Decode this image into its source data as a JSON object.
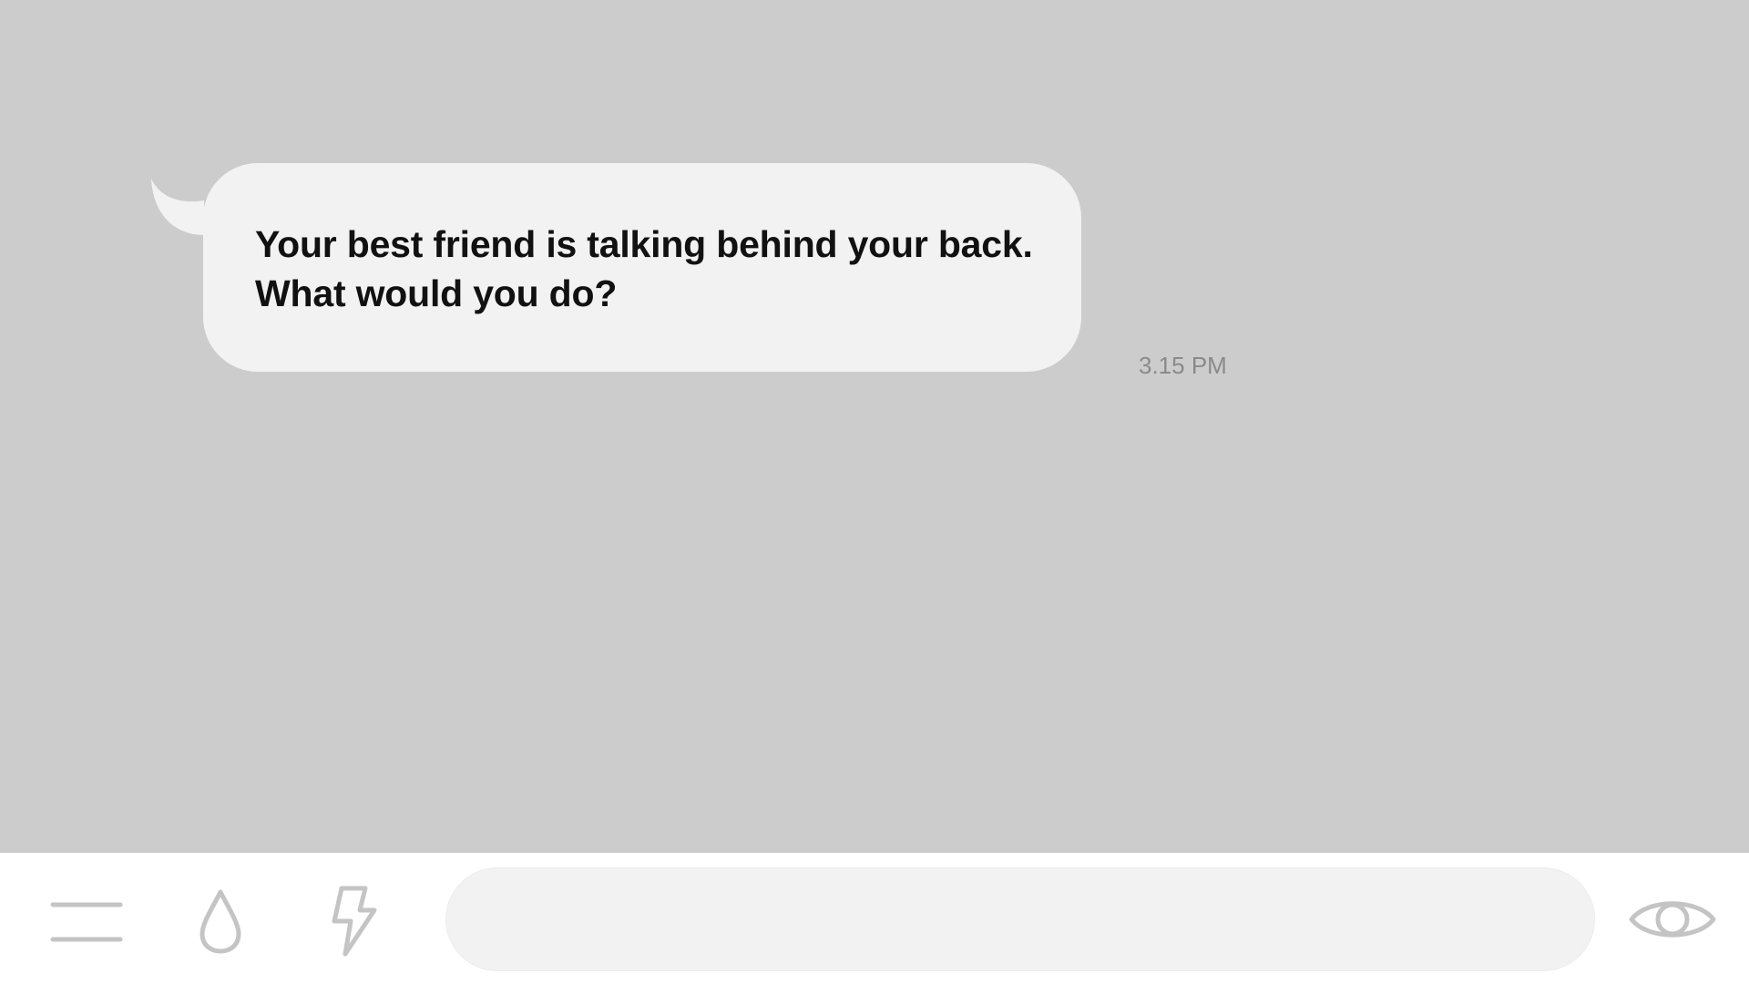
{
  "chat": {
    "message": {
      "line1": "Your best friend is talking behind your back.",
      "line2": "What would you do?"
    },
    "timestamp": "3.15 PM"
  },
  "composer": {
    "input_value": "",
    "input_placeholder": ""
  },
  "icons": {
    "menu": "menu-icon",
    "drop": "drop-icon",
    "bolt": "lightning-icon",
    "eye": "eye-icon"
  },
  "colors": {
    "chat_background": "#cccccc",
    "bubble": "#f2f2f2",
    "bar_background": "#ffffff",
    "icon_stroke": "#c4c4c4",
    "timestamp": "#8a8a8a"
  }
}
